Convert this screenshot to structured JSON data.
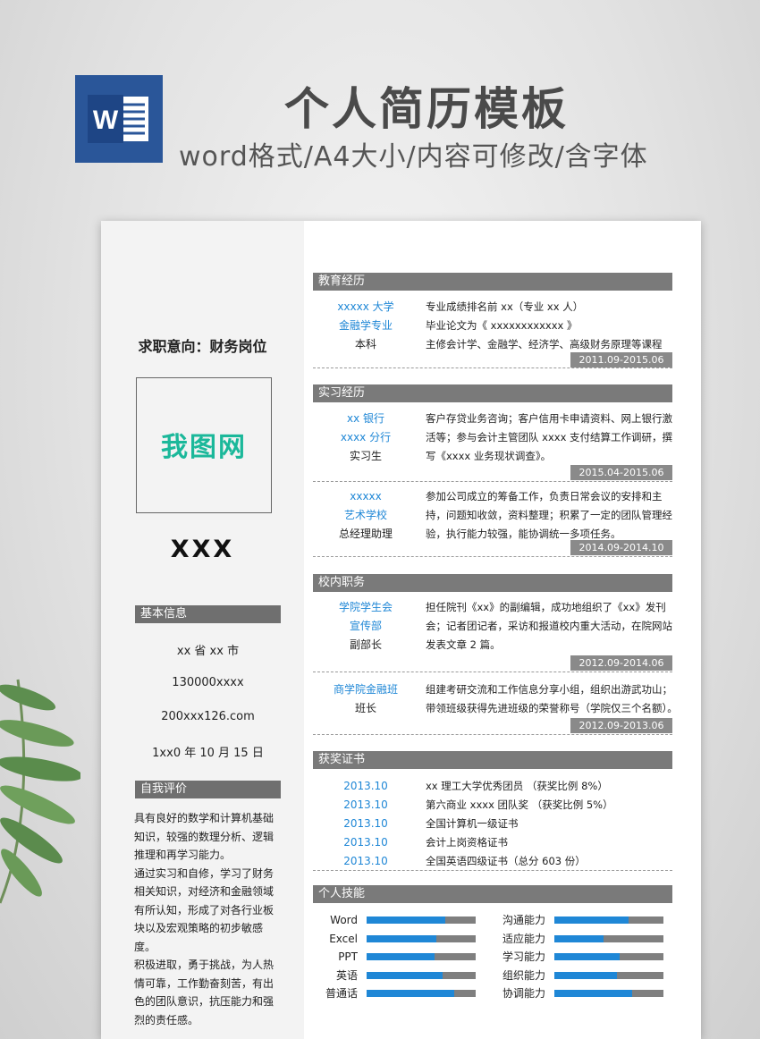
{
  "header": {
    "logo_letter": "W",
    "title": "个人简历模板",
    "subtitle": "word格式/A4大小/内容可修改/含字体"
  },
  "sidebar": {
    "job_target": "求职意向：财务岗位",
    "photo_text": "我图网",
    "name": "XXX",
    "basic_info_title": "基本信息",
    "basic_info": [
      "xx 省 xx 市",
      "130000xxxx",
      "200xxx126.com",
      "1xx0 年 10 月 15 日"
    ],
    "self_eval_title": "自我评价",
    "self_eval": [
      "具有良好的数学和计算机基础知识，较强的数理分析、逻辑推理和再学习能力。",
      "通过实习和自修，学习了财务相关知识，对经济和金融领域有所认知，形成了对各行业板块以及宏观策略的初步敏感度。",
      "积极进取，勇于挑战，为人热情可靠，工作勤奋刻苦，有出色的团队意识，抗压能力和强烈的责任感。"
    ]
  },
  "education": {
    "title": "教育经历",
    "school": "xxxxx 大学",
    "major": "金融学专业",
    "degree": "本科",
    "details": [
      "专业成绩排名前 xx（专业 xx 人）",
      "毕业论文为《 xxxxxxxxxxxx 》",
      "主修会计学、金融学、经济学、高级财务原理等课程"
    ],
    "date": "2011.09-2015.06"
  },
  "internship": {
    "title": "实习经历",
    "items": [
      {
        "org1": "xx 银行",
        "org2": "xxxx 分行",
        "role": "实习生",
        "desc": "客户存贷业务咨询；客户信用卡申请资料、网上银行激活等；参与会计主管团队 xxxx 支付结算工作调研，撰写《xxxx 业务现状调查》。",
        "date": "2015.04-2015.06"
      },
      {
        "org1": "xxxxx",
        "org2": "艺术学校",
        "role": "总经理助理",
        "desc": "参加公司成立的筹备工作，负责日常会议的安排和主持，问题知收敛，资料整理；积累了一定的团队管理经验，执行能力较强，能协调统一多项任务。",
        "date": "2014.09-2014.10"
      }
    ]
  },
  "campus": {
    "title": "校内职务",
    "items": [
      {
        "org1": "学院学生会",
        "org2": "宣传部",
        "role": "副部长",
        "desc": "担任院刊《xx》的副编辑，成功地组织了《xx》发刊会；记者团记者，采访和报道校内重大活动，在院网站发表文章 2 篇。",
        "date": "2012.09-2014.06"
      },
      {
        "org1": "商学院金融班",
        "role": "班长",
        "lines": [
          "组建考研交流和工作信息分享小组，组织出游武功山；",
          "带领班级获得先进班级的荣誉称号（学院仅三个名额）。"
        ],
        "date": "2012.09-2013.06"
      }
    ]
  },
  "awards": {
    "title": "获奖证书",
    "items": [
      {
        "year": "2013.10",
        "text": "xx 理工大学优秀团员 （获奖比例 8%）"
      },
      {
        "year": "2013.10",
        "text": "第六商业 xxxx 团队奖 （获奖比例 5%）"
      },
      {
        "year": "2013.10",
        "text": "全国计算机一级证书"
      },
      {
        "year": "2013.10",
        "text": "会计上岗资格证书"
      },
      {
        "year": "2013.10",
        "text": "全国英语四级证书（总分 603 份）"
      }
    ]
  },
  "skills": {
    "title": "个人技能",
    "left": [
      {
        "name": "Word",
        "level": 0.72
      },
      {
        "name": "Excel",
        "level": 0.64
      },
      {
        "name": "PPT",
        "level": 0.62
      },
      {
        "name": "英语",
        "level": 0.7
      },
      {
        "name": "普通话",
        "level": 0.8
      }
    ],
    "right": [
      {
        "name": "沟通能力",
        "level": 0.68
      },
      {
        "name": "适应能力",
        "level": 0.45
      },
      {
        "name": "学习能力",
        "level": 0.6
      },
      {
        "name": "组织能力",
        "level": 0.57
      },
      {
        "name": "协调能力",
        "level": 0.71
      }
    ]
  },
  "colors": {
    "accent_blue": "#1f87d6",
    "section_gray": "#7a7a7a",
    "word_blue": "#2a5699",
    "photo_text_green": "#1bb89a"
  }
}
